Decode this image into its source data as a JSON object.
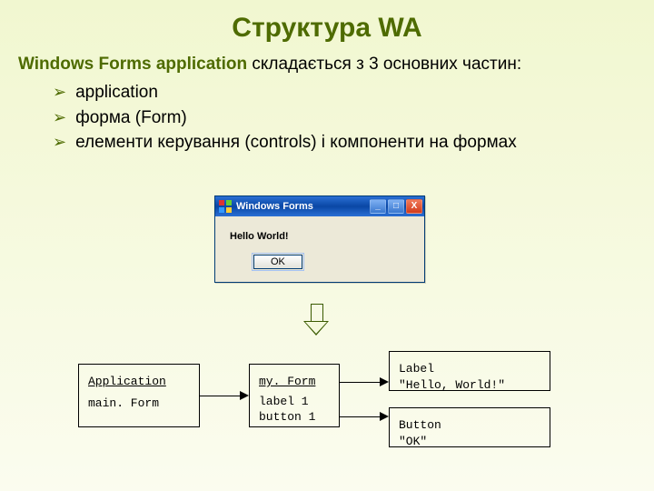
{
  "title": "Структура WA",
  "intro_bold": "Windows Forms application",
  "intro_rest": " складається з 3 основних частин:",
  "bullets": [
    "application",
    "форма (Form)",
    "елементи керування (controls) і компоненти на формах"
  ],
  "window": {
    "title": "Windows Forms",
    "btn_min": "_",
    "btn_max": "□",
    "btn_close": "X",
    "hello_text": "Hello World!",
    "ok_label": "OK"
  },
  "boxes": {
    "application": {
      "line1": "Application",
      "line2": "main. Form"
    },
    "form": {
      "line1": "my. Form",
      "line2": "label 1",
      "line3": "button 1"
    },
    "label": {
      "line1": "Label",
      "line2": "\"Hello, World!\""
    },
    "button": {
      "line1": "Button",
      "line2": "\"OK\""
    }
  }
}
